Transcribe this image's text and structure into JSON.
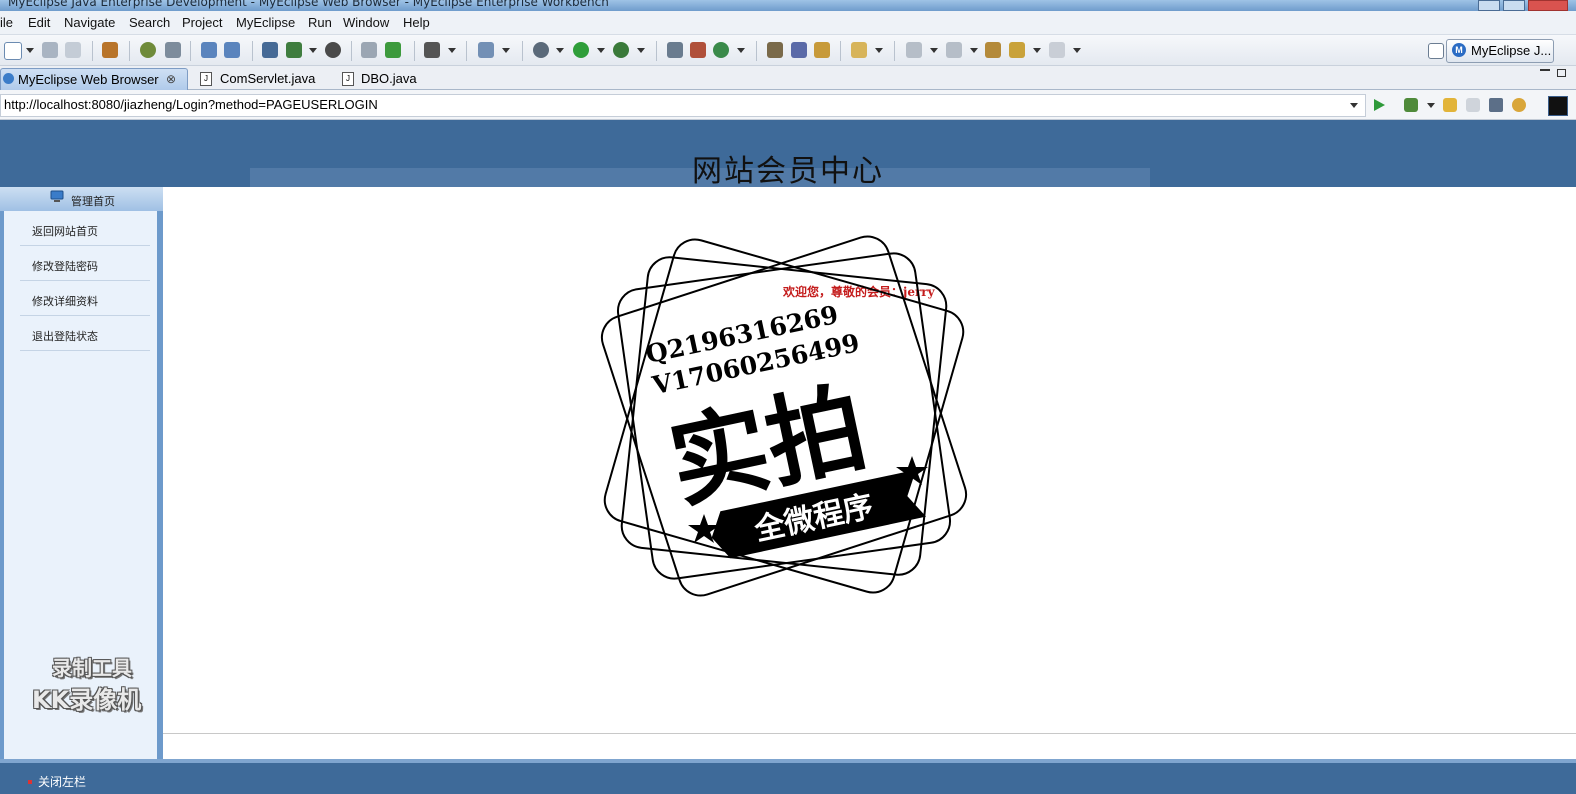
{
  "window": {
    "title": "MyEclipse Java Enterprise Development - MyEclipse Web Browser - MyEclipse Enterprise Workbench"
  },
  "menu": [
    "ile",
    "Edit",
    "Navigate",
    "Search",
    "Project",
    "MyEclipse",
    "Run",
    "Window",
    "Help"
  ],
  "perspective": {
    "label": "MyEclipse J..."
  },
  "tabs": [
    {
      "label": "MyEclipse Web Browser",
      "active": true
    },
    {
      "label": "ComServlet.java",
      "active": false
    },
    {
      "label": "DBO.java",
      "active": false
    }
  ],
  "address": {
    "url": "http://localhost:8080/jiazheng/Login?method=PAGEUSERLOGIN"
  },
  "page": {
    "title": "网站会员中心",
    "sidebar_header": "管理首页",
    "sidebar_items": [
      "返回网站首页",
      "修改登陆密码",
      "修改详细资料",
      "退出登陆状态"
    ],
    "welcome": "欢迎您，尊敬的会员：jerry",
    "footer_toggle": "关闭左栏"
  },
  "stamp": {
    "line1": "Q2196316269",
    "line2": "V17060256499",
    "big_text": "实拍",
    "ribbon_text": "全微程序"
  },
  "watermark": {
    "line1": "录制工具",
    "line2": "KK录像机"
  },
  "colors": {
    "header_blue": "#3e6a99",
    "sidebar_blue": "#6d9acb",
    "welcome_red": "#c41c1c"
  }
}
